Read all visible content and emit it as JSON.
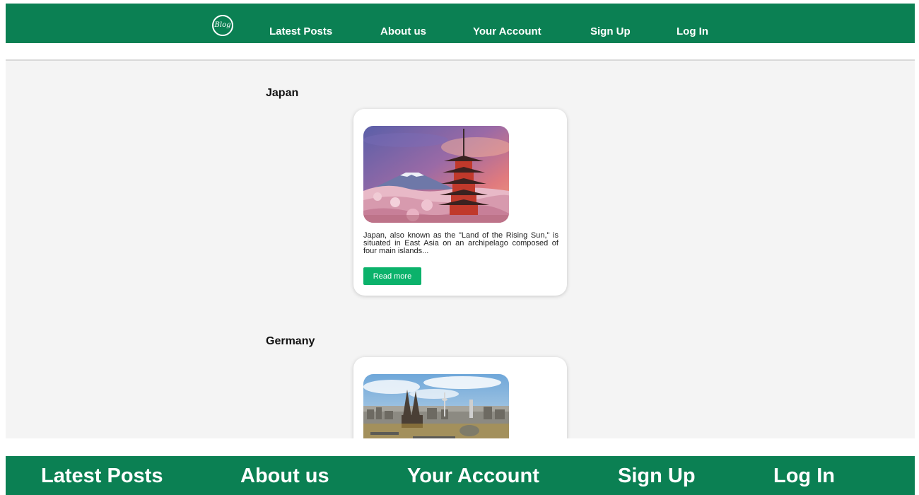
{
  "nav": {
    "logo_text": "Blog",
    "links": [
      "Latest Posts",
      "About us",
      "Your Account",
      "Sign Up",
      "Log In"
    ]
  },
  "posts": [
    {
      "title": "Japan",
      "excerpt": "Japan, also known as the \"Land of the Rising Sun,\" is situated in East Asia on an archipelago composed of four main islands...",
      "button": "Read more",
      "image": "pagoda with mount fuji and cherry blossoms at sunset"
    },
    {
      "title": "Germany",
      "image": "city skyline with cathedral twin spires and tv tower"
    }
  ],
  "footer_nav": {
    "links": [
      "Latest Posts",
      "About us",
      "Your Account",
      "Sign Up",
      "Log In"
    ]
  },
  "colors": {
    "nav_green": "#0b8053",
    "button_green": "#0bb26b",
    "content_bg": "#f4f4f4"
  }
}
